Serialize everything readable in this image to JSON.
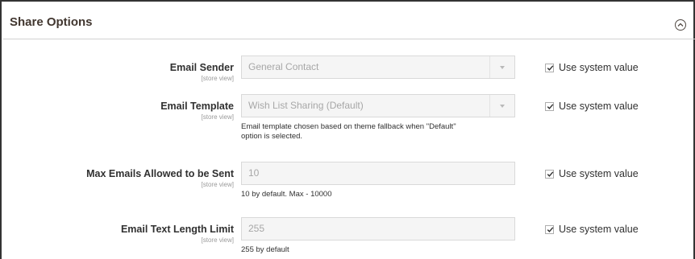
{
  "section": {
    "title": "Share Options",
    "toggle_icon": "chevron-up-circle-icon"
  },
  "fields": [
    {
      "label": "Email Sender",
      "scope": "[store view]",
      "value": "General Contact",
      "type": "select",
      "note": "",
      "use_system_value": true,
      "system_label": "Use system value"
    },
    {
      "label": "Email Template",
      "scope": "[store view]",
      "value": "Wish List Sharing (Default)",
      "type": "select",
      "note_line1": "Email template chosen based on theme fallback when \"Default\"",
      "note_line2": "option is selected.",
      "use_system_value": true,
      "system_label": "Use system value"
    },
    {
      "label": "Max Emails Allowed to be Sent",
      "scope": "[store view]",
      "value": "10",
      "type": "text",
      "note": "10 by default. Max - 10000",
      "use_system_value": true,
      "system_label": "Use system value"
    },
    {
      "label": "Email Text Length Limit",
      "scope": "[store view]",
      "value": "255",
      "type": "text",
      "note": "255 by default",
      "use_system_value": true,
      "system_label": "Use system value"
    }
  ]
}
